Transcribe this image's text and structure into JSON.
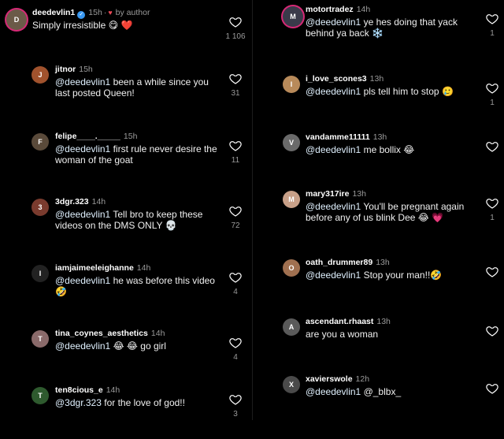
{
  "left": [
    {
      "user": "deedevlin1",
      "verified": true,
      "time": "15h",
      "by_author": "by author",
      "text": "Simply irresistible 😋 ❤️",
      "likes": "1 106",
      "avatar_color": "#6b5a48",
      "avatar_initial": "D"
    },
    {
      "user": "jitnor",
      "time": "15h",
      "mention": "@deedevlin1",
      "text": " been a while since you\nlast posted Queen!",
      "likes": "31",
      "avatar_color": "#a0522d",
      "avatar_initial": "J"
    },
    {
      "user": "felipe____._____",
      "time": "15h",
      "mention": "@deedevlin1",
      "text": " first rule never desire the\nwoman of the goat",
      "likes": "11",
      "avatar_color": "#5a4a3a",
      "avatar_initial": "F"
    },
    {
      "user": "3dgr.323",
      "time": "14h",
      "mention": "@deedevlin1",
      "text": " Tell bro to keep these\nvideos on the DMS ONLY 💀",
      "likes": "72",
      "avatar_color": "#7a3b2e",
      "avatar_initial": "3"
    },
    {
      "user": "iamjaimeeleighanne",
      "time": "14h",
      "mention": "@deedevlin1",
      "text": " he was before this video\n🤣",
      "likes": "4",
      "avatar_color": "#222",
      "avatar_initial": "I"
    },
    {
      "user": "tina_coynes_aesthetics",
      "time": "14h",
      "mention": "@deedevlin1",
      "text": " 😂  😂  go girl",
      "likes": "4",
      "avatar_color": "#8a6a6a",
      "avatar_initial": "T"
    },
    {
      "user": "ten8cious_e",
      "time": "14h",
      "mention": "@3dgr.323",
      "text": " for the love of god!!",
      "likes": "3",
      "avatar_color": "#2e5a2e",
      "avatar_initial": "T"
    }
  ],
  "right": [
    {
      "user": "motortradez",
      "time": "14h",
      "mention": "@deedevlin1",
      "text": " ye hes doing that yack\nbehind ya back ❄️",
      "likes": "1",
      "avatar_color": "#3a3a4a",
      "avatar_initial": "M"
    },
    {
      "user": "i_love_scones3",
      "time": "13h",
      "mention": "@deedevlin1",
      "text": " pls tell him to stop 🥲",
      "likes": "1",
      "avatar_color": "#b88a5a",
      "avatar_initial": "I"
    },
    {
      "user": "vandamme11111",
      "time": "13h",
      "mention": "@deedevlin1",
      "text": " me bollix 😂",
      "likes": "",
      "avatar_color": "#6a6a6a",
      "avatar_initial": "V"
    },
    {
      "user": "mary317ire",
      "time": "13h",
      "mention": "@deedevlin1",
      "text": " You'll be pregnant again\nbefore any of us blink Dee 😂 💗",
      "likes": "1",
      "avatar_color": "#c8a088",
      "avatar_initial": "M"
    },
    {
      "user": "oath_drummer89",
      "time": "13h",
      "mention": "@deedevlin1",
      "text": " Stop your man!!🤣",
      "likes": "",
      "avatar_color": "#a07050",
      "avatar_initial": "O"
    },
    {
      "user": "ascendant.rhaast",
      "time": "13h",
      "mention": "",
      "text": "are you a woman",
      "likes": "",
      "avatar_color": "#5a5a5a",
      "avatar_initial": "A"
    },
    {
      "user": "xavierswole",
      "time": "12h",
      "mention": "@deedevlin1",
      "text": " @_blbx_",
      "likes": "",
      "avatar_color": "#4a4a4a",
      "avatar_initial": "X"
    }
  ]
}
